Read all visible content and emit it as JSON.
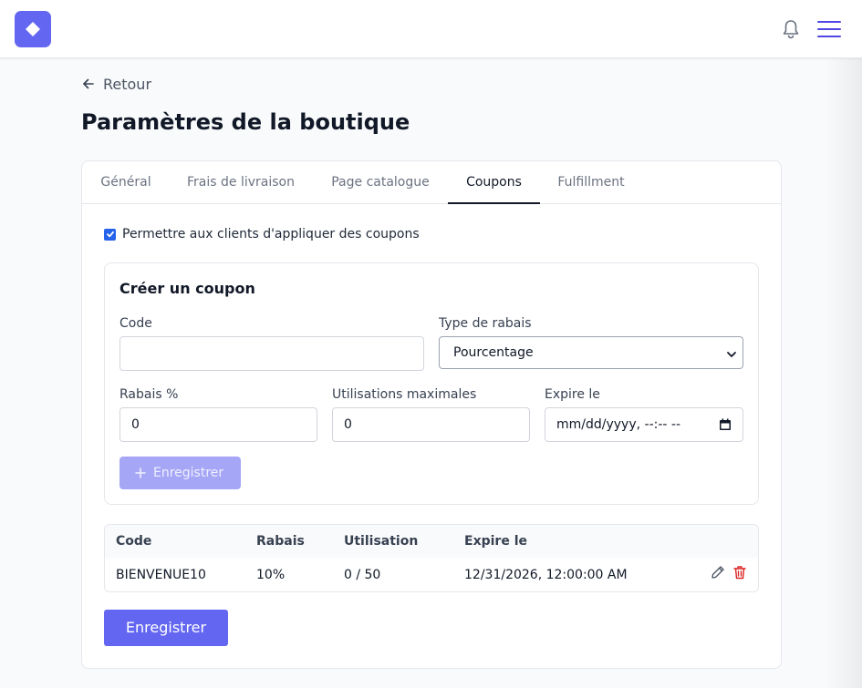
{
  "nav": {
    "back_label": "Retour"
  },
  "page": {
    "title": "Paramètres de la boutique"
  },
  "tabs": [
    {
      "label": "Général",
      "active": false
    },
    {
      "label": "Frais de livraison",
      "active": false
    },
    {
      "label": "Page catalogue",
      "active": false
    },
    {
      "label": "Coupons",
      "active": true
    },
    {
      "label": "Fulfillment",
      "active": false
    }
  ],
  "coupons": {
    "allow_label": "Permettre aux clients d'appliquer des coupons",
    "allow_checked": true,
    "form": {
      "title": "Créer un coupon",
      "code_label": "Code",
      "code_value": "",
      "type_label": "Type de rabais",
      "type_value": "Pourcentage",
      "discount_label": "Rabais %",
      "discount_value": "0",
      "max_uses_label": "Utilisations maximales",
      "max_uses_value": "0",
      "expires_label": "Expire le",
      "expires_placeholder": "mm/dd/yyyy, --:-- --",
      "save_label": "Enregistrer"
    },
    "table": {
      "headers": [
        "Code",
        "Rabais",
        "Utilisation",
        "Expire le"
      ],
      "rows": [
        {
          "code": "BIENVENUE10",
          "discount": "10%",
          "usage": "0 / 50",
          "expires": "12/31/2026, 12:00:00 AM"
        }
      ]
    },
    "save_label": "Enregistrer"
  },
  "colors": {
    "accent": "#6366f1",
    "accent_disabled": "#a5a6f6",
    "checkbox": "#2563eb",
    "danger": "#dc2626"
  },
  "icons": [
    "logo-diamond-icon",
    "bell-icon",
    "hamburger-menu-icon",
    "arrow-left-icon",
    "plus-icon",
    "pencil-icon",
    "trash-icon",
    "calendar-icon",
    "chevron-down-icon",
    "checkmark-icon"
  ]
}
